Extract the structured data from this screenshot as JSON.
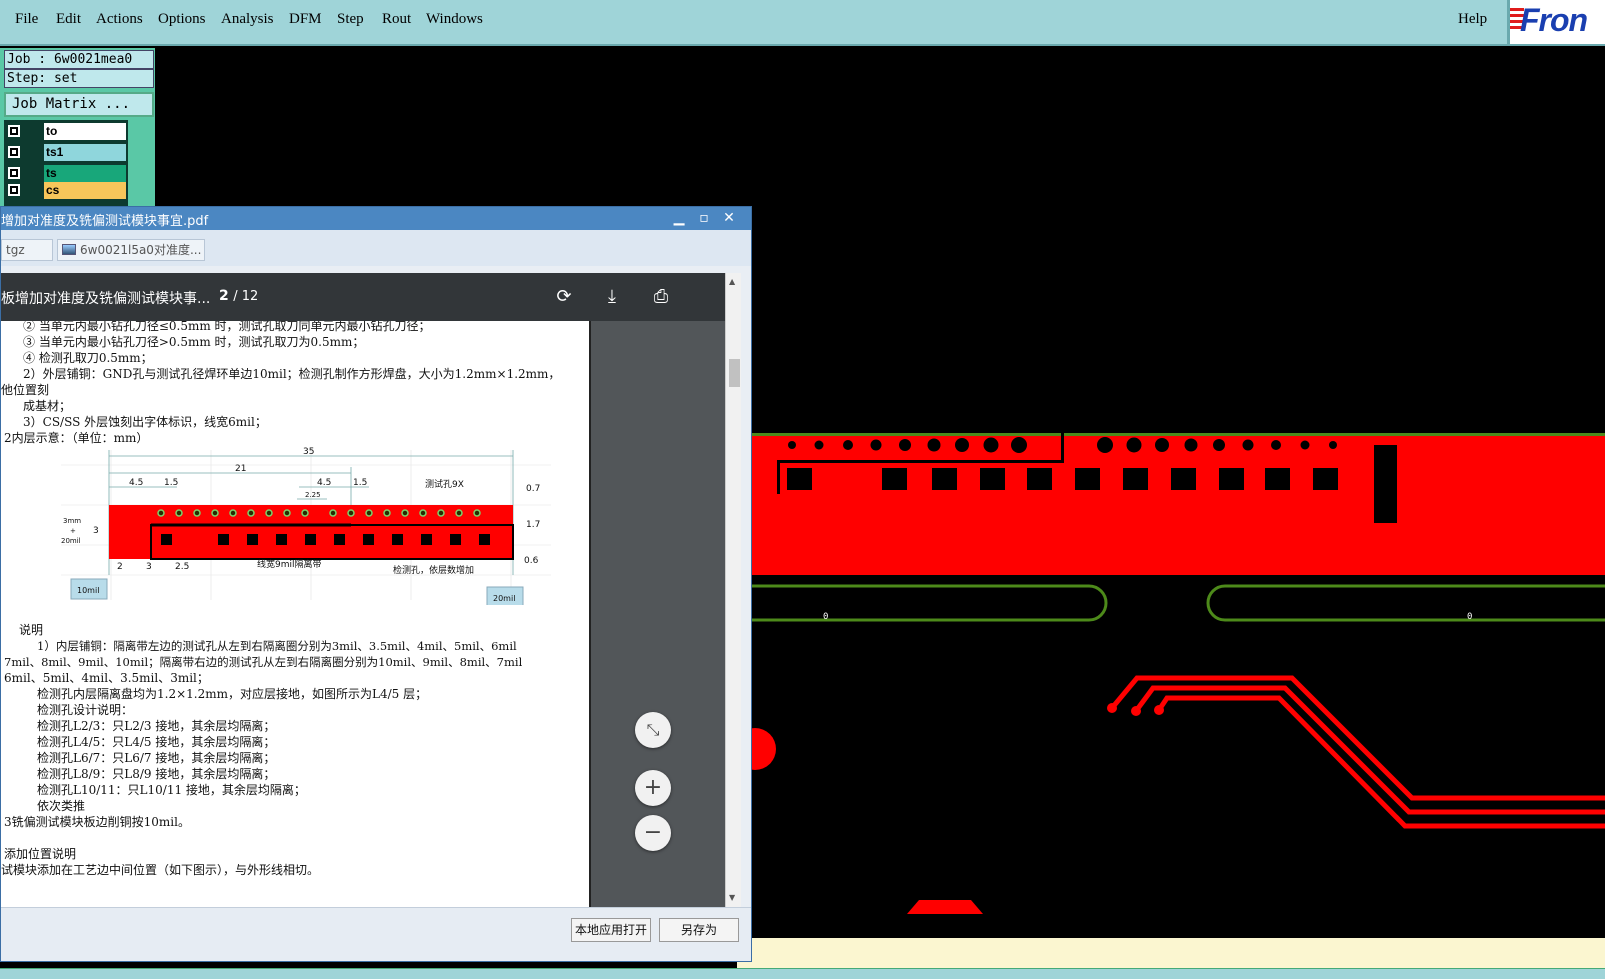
{
  "menubar": {
    "items": [
      "File",
      "Edit",
      "Actions",
      "Options",
      "Analysis",
      "DFM",
      "Step",
      "Rout",
      "Windows"
    ],
    "help": "Help",
    "logo": "Fron"
  },
  "sidepanel": {
    "job": "Job : 6w0021mea0",
    "step": "Step: set",
    "job_matrix": "Job Matrix ...",
    "layers": [
      {
        "name": "to",
        "color": "#ffffff"
      },
      {
        "name": "ts1",
        "color": "#8fd6dc"
      },
      {
        "name": "ts",
        "color": "#18a77a"
      },
      {
        "name": "cs",
        "color": "#f7c65a"
      }
    ]
  },
  "canvas": {
    "label_left": "0",
    "label_right": "0",
    "colors": {
      "copper": "#ff0000",
      "outline": "#4d8a1a",
      "background": "#000000"
    }
  },
  "pdfwindow": {
    "title": "增加对准度及铣偏测试模块事宜.pdf",
    "tabs": [
      "tgz",
      "6w0021l5a0对准度..."
    ],
    "toolbar": {
      "doc_title": "板增加对准度及铣偏测试模块事...",
      "page_current": "2",
      "page_total": "/ 12"
    },
    "text_lines": [
      "②  当单元内最小钻孔刀径≤0.5mm 时，测试孔取刀同单元内最小钻孔刀径；",
      "③  当单元内最小钻孔刀径>0.5mm 时，测试孔取刀为0.5mm；",
      "④  检测孔取刀0.5mm；",
      "2）外层铺铜：GND孔与测试孔径焊环单边10mil；检测孔制作方形焊盘，大小为1.2mm×1.2mm，",
      "他位置刻",
      "成基材；",
      "3）CS/SS 外层蚀刻出字体标识，线宽6mil；",
      "2内层示意：（单位：mm）"
    ],
    "diagram": {
      "dims": [
        "35",
        "21",
        "4.5",
        "1.5",
        "4.5",
        "1.5",
        "2.25",
        "0.7",
        "1.7",
        "0.6",
        "3",
        "2",
        "3",
        "2.5"
      ],
      "labels": [
        "测试孔9X",
        "线宽9mil隔离带",
        "检测孔，依层数增加",
        "10mil",
        "20mil",
        "3mm",
        "+",
        "20mil"
      ]
    },
    "body_lines": [
      "说明",
      "1）内层铺铜：隔离带左边的测试孔从左到右隔离圈分别为3mil、3.5mil、4mil、5mil、6mil",
      "7mil、8mil、9mil、10mil；隔离带右边的测试孔从左到右隔离圈分别为10mil、9mil、8mil、7mil",
      "6mil、5mil、4mil、3.5mil、3mil；",
      "检测孔内层隔离盘均为1.2×1.2mm，对应层接地，如图所示为L4/5 层；",
      "检测孔设计说明：",
      "检测孔L2/3：只L2/3 接地，其余层均隔离；",
      "检测孔L4/5：只L4/5 接地，其余层均隔离；",
      "检测孔L6/7：只L6/7 接地，其余层均隔离；",
      "检测孔L8/9：只L8/9 接地，其余层均隔离；",
      "检测孔L10/11：只L10/11 接地，其余层均隔离；",
      "依次类推",
      "3铣偏测试模块板边削铜按10mil。",
      "添加位置说明",
      "试模块添加在工艺边中间位置（如下图示），与外形线相切。"
    ],
    "footer": {
      "open_local": "本地应用打开",
      "save_as": "另存为"
    }
  }
}
